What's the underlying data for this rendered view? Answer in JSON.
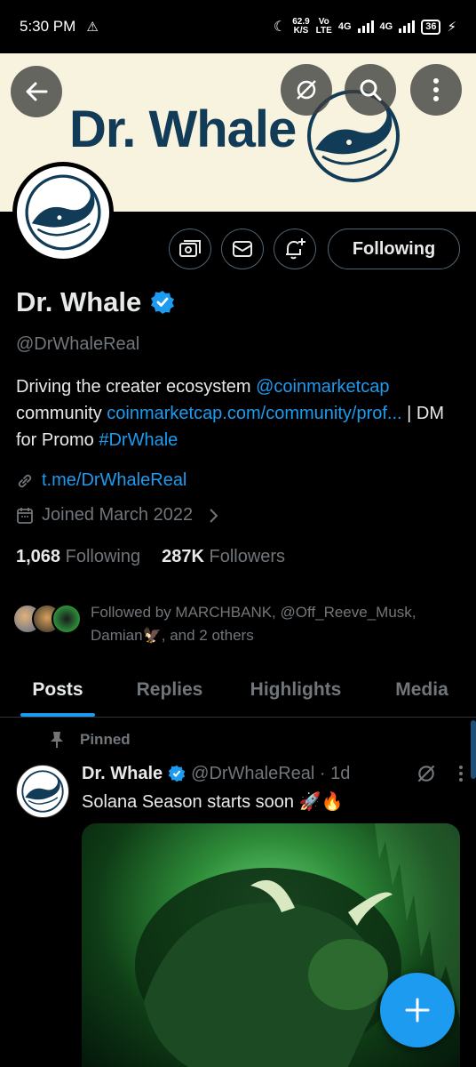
{
  "status_bar": {
    "time": "5:30 PM",
    "warning_icon": "warning-triangle-icon",
    "speed_value": "62.9",
    "speed_unit": "K/S",
    "volte_top": "Vo",
    "volte_bottom": "LTE",
    "net1": "4G",
    "net2": "4G",
    "battery": "36"
  },
  "banner": {
    "title": "Dr. Whale",
    "background": "#f7f3df",
    "title_color": "#113b57"
  },
  "profile": {
    "name": "Dr. Whale",
    "handle": "@DrWhaleReal",
    "following_label": "Following",
    "bio": {
      "part1": "Driving the creater ecosystem ",
      "mention": "@coinmarketcap",
      "part2": " community ",
      "url": "coinmarketcap.com/community/prof...",
      "part3": " | DM for Promo  ",
      "hashtag": "#DrWhale"
    },
    "website": "t.me/DrWhaleReal",
    "joined": "Joined March 2022",
    "following_count": "1,068",
    "following_text": "Following",
    "followers_count": "287K",
    "followers_text": "Followers",
    "followed_by": "Followed by MARCHBANK, @Off_Reeve_Musk, Damian🦅, and 2 others"
  },
  "tabs": [
    {
      "label": "Posts"
    },
    {
      "label": "Replies"
    },
    {
      "label": "Highlights"
    },
    {
      "label": "Media"
    }
  ],
  "post": {
    "pinned_label": "Pinned",
    "name": "Dr. Whale",
    "handle": "@DrWhaleReal · 1d",
    "text": "Solana Season starts soon 🚀🔥"
  },
  "colors": {
    "accent": "#1d9bf0",
    "muted": "#71767b",
    "text": "#e7e9ea"
  }
}
